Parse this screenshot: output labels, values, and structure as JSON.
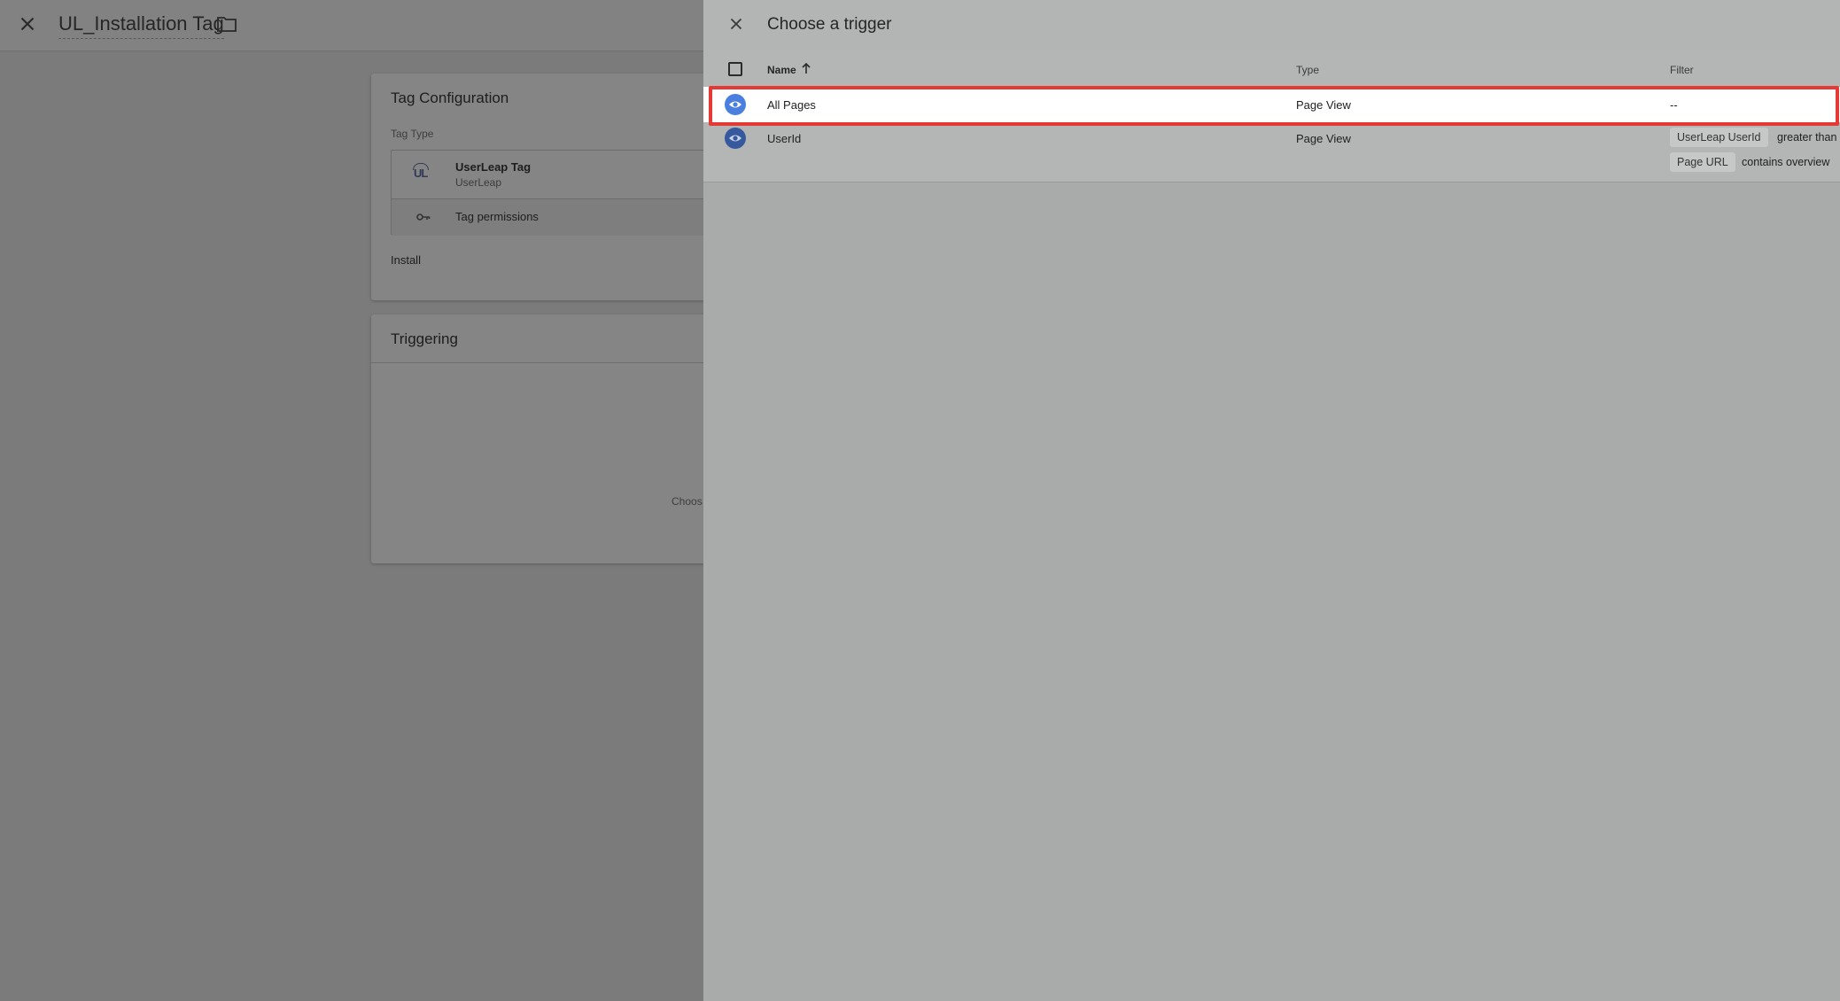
{
  "editor": {
    "title": "UL_Installation Tag",
    "config_card": {
      "title": "Tag Configuration",
      "tag_type_label": "Tag Type",
      "tag_name": "UserLeap Tag",
      "tag_vendor": "UserLeap",
      "logo_text": "UL",
      "permissions_label": "Tag permissions",
      "install_label": "Install"
    },
    "trigger_card": {
      "title": "Triggering",
      "hint_text": "Choos"
    }
  },
  "panel": {
    "title": "Choose a trigger",
    "columns": {
      "name": "Name",
      "type": "Type",
      "filter": "Filter"
    },
    "rows": [
      {
        "name": "All Pages",
        "type": "Page View",
        "filter": "--",
        "selected": true
      },
      {
        "name": "UserId",
        "type": "Page View",
        "filters": [
          {
            "variable": "UserLeap UserId",
            "condition": "greater than"
          },
          {
            "variable": "Page URL",
            "condition": "contains overview"
          }
        ]
      }
    ]
  },
  "colors": {
    "highlight_border": "#e53935",
    "eye_icon_active": "#4a7fe0",
    "eye_icon": "#36589c",
    "selected_row_bg": "#ffffff"
  },
  "icons": [
    "close-icon",
    "folder-icon",
    "key-icon",
    "sort-arrow-up-icon",
    "eye-icon",
    "checkbox-icon"
  ]
}
